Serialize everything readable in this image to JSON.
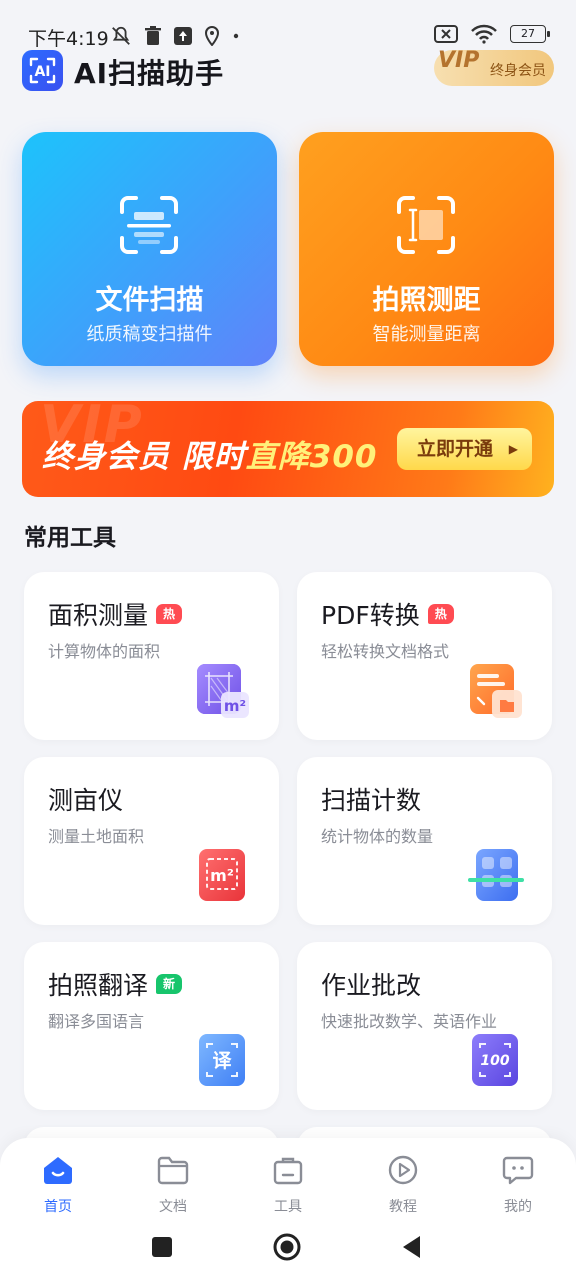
{
  "status_bar": {
    "time": "下午4:19",
    "battery": "27",
    "icons": [
      "mute-icon",
      "trash-icon",
      "upload-icon",
      "location-icon",
      "dot-icon",
      "sim-off-icon",
      "wifi-icon",
      "battery-icon"
    ]
  },
  "header": {
    "title": "AI扫描助手",
    "logo_text": "AI",
    "vip_word": "VIP",
    "vip_label": "终身会员"
  },
  "big_cards": [
    {
      "title": "文件扫描",
      "subtitle": "纸质稿变扫描件",
      "icon": "scan-document-icon",
      "color_start": "#1dc3fb",
      "color_end": "#6182fa"
    },
    {
      "title": "拍照测距",
      "subtitle": "智能测量距离",
      "icon": "measure-distance-icon",
      "color_start": "#ffa01f",
      "color_end": "#ff6d13"
    }
  ],
  "banner": {
    "deco": "VIP",
    "text_a": "终身会员 限时",
    "text_b": "直降300",
    "button": "立即开通"
  },
  "section": {
    "title": "常用工具"
  },
  "tools": [
    {
      "title": "面积测量",
      "tag": "热",
      "subtitle": "计算物体的面积",
      "icon": "area-measure-icon",
      "icon_text": "m²"
    },
    {
      "title": "PDF转换",
      "tag": "热",
      "subtitle": "轻松转换文档格式",
      "icon": "pdf-convert-icon",
      "icon_text": ""
    },
    {
      "title": "测亩仪",
      "tag": "",
      "subtitle": "测量土地面积",
      "icon": "land-measure-icon",
      "icon_text": "m²"
    },
    {
      "title": "扫描计数",
      "tag": "",
      "subtitle": "统计物体的数量",
      "icon": "scan-count-icon",
      "icon_text": ""
    },
    {
      "title": "拍照翻译",
      "tag": "新",
      "subtitle": "翻译多国语言",
      "icon": "translate-icon",
      "icon_text": "译"
    },
    {
      "title": "作业批改",
      "tag": "",
      "subtitle": "快速批改数学、英语作业",
      "icon": "homework-check-icon",
      "icon_text": "100"
    }
  ],
  "bottom_nav": [
    {
      "label": "首页",
      "icon": "home-icon",
      "active": true
    },
    {
      "label": "文档",
      "icon": "folder-icon",
      "active": false
    },
    {
      "label": "工具",
      "icon": "toolbox-icon",
      "active": false
    },
    {
      "label": "教程",
      "icon": "play-icon",
      "active": false
    },
    {
      "label": "我的",
      "icon": "profile-icon",
      "active": false
    }
  ],
  "colors": {
    "accent": "#2e6bff",
    "hot_tag": "#ff4b52",
    "new_tag": "#17c56c",
    "background": "#f3f4f8"
  }
}
